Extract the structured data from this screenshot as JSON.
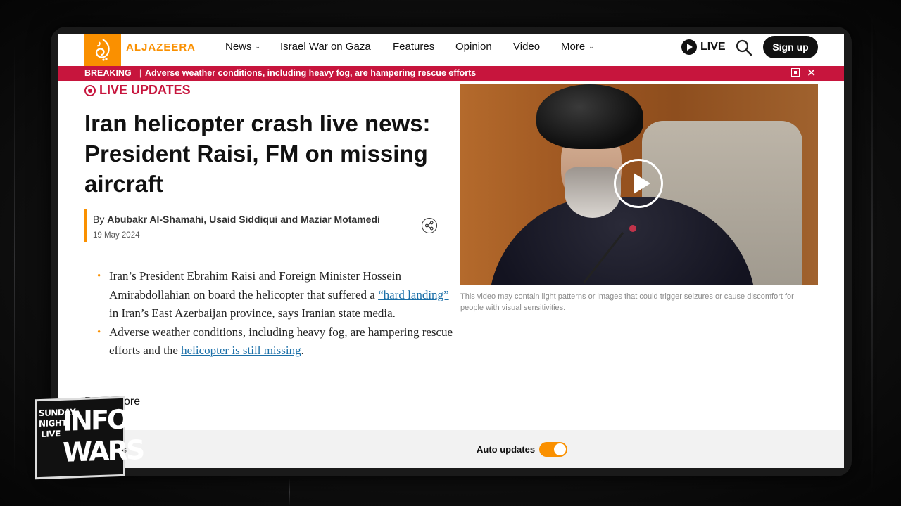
{
  "site": {
    "logo_text": "ALJAZEERA",
    "accent": "#fa9000",
    "breaking_color": "#c7153d"
  },
  "nav": {
    "items": [
      {
        "label": "News",
        "has_dropdown": true
      },
      {
        "label": "Israel War on Gaza",
        "has_dropdown": false
      },
      {
        "label": "Features",
        "has_dropdown": false
      },
      {
        "label": "Opinion",
        "has_dropdown": false
      },
      {
        "label": "Video",
        "has_dropdown": false
      },
      {
        "label": "More",
        "has_dropdown": true
      }
    ],
    "live_label": "LIVE",
    "signup_label": "Sign up"
  },
  "breaking": {
    "label": "BREAKING",
    "separator": "|",
    "headline": "Adverse weather conditions, including heavy fog, are hampering rescue efforts"
  },
  "article": {
    "live_updates_label": "LIVE UPDATES",
    "title": "Iran helicopter crash live news: President Raisi, FM on missing aircraft",
    "by_prefix": "By",
    "authors": "Abubakr Al-Shamahi, Usaid Siddiqui and Maziar Motamedi",
    "date": "19 May 2024",
    "bullet1_a": "Iran’s President Ebrahim Raisi and Foreign Minister Hossein Amirabdollahian on board the helicopter that suffered a ",
    "bullet1_link": "“hard landing”",
    "bullet1_b": " in Iran’s East Azerbaijan province, says Iranian state media.",
    "bullet2_a": "Adverse weather conditions, including heavy fog, are hampering rescue efforts and the ",
    "bullet2_link": "helicopter is still missing",
    "bullet2_b": ".",
    "read_more": "Read more"
  },
  "video": {
    "caption": "This video may contain light patterns or images that could trigger seizures or cause discomfort for people with visual sensitivities."
  },
  "bottom_bar": {
    "left_text": "s",
    "auto_updates_label": "Auto updates",
    "auto_updates_on": true
  },
  "overlay": {
    "badge_small": "SUNDAY NIGHT LIVE",
    "badge_large": "INFO WARS"
  }
}
